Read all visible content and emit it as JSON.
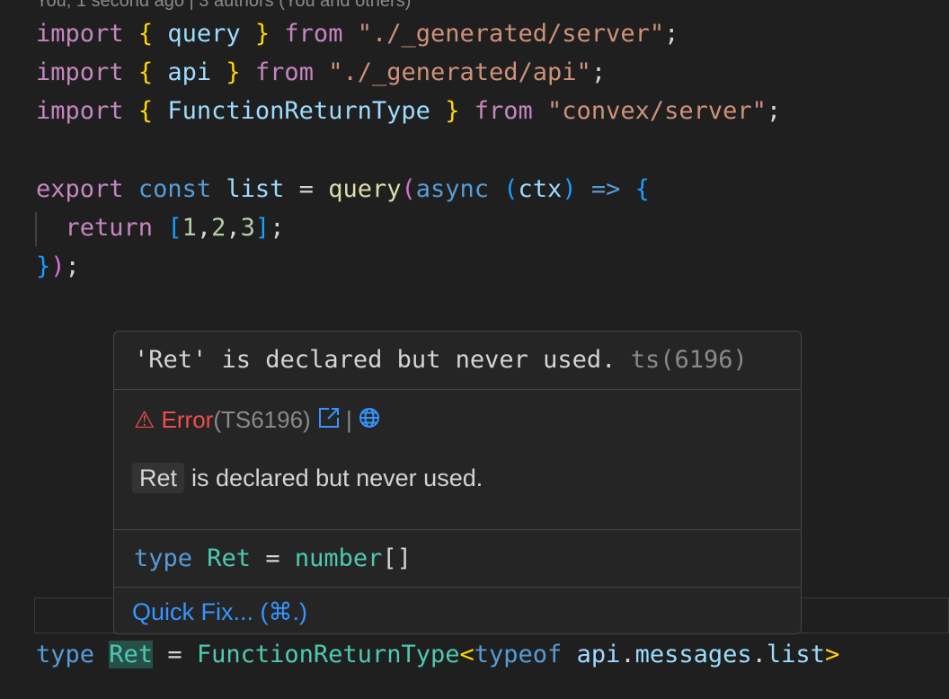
{
  "editor": {
    "blame": "You, 1 second ago | 3 authors (You and others)",
    "line1": {
      "kw": "import",
      "ob": "{",
      "name": "query",
      "cb": "}",
      "from": "from",
      "src": "\"./_generated/server\"",
      "semi": ";"
    },
    "line2": {
      "kw": "import",
      "ob": "{",
      "name": "api",
      "cb": "}",
      "from": "from",
      "src": "\"./_generated/api\"",
      "semi": ";"
    },
    "line3": {
      "kw": "import",
      "ob": "{",
      "name": "FunctionReturnType",
      "cb": "}",
      "from": "from",
      "src": "\"convex/server\"",
      "semi": ";"
    },
    "line4": {
      "export": "export",
      "const": "const",
      "name": "list",
      "eq": "=",
      "fn": "query",
      "lp": "(",
      "async": "async",
      "plp": "(",
      "arg": "ctx",
      "prp": ")",
      "arrow": "=>",
      "ob": "{"
    },
    "line5": {
      "ret": "return",
      "lb": "[",
      "n1": "1",
      "c1": ",",
      "n2": "2",
      "c2": ",",
      "n3": "3",
      "rb": "]",
      "semi": ";"
    },
    "line6": {
      "cb": "}",
      "rp": ")",
      "semi": ";"
    },
    "line7": {
      "type": "type",
      "name": "Ret",
      "eq": "=",
      "fn": "FunctionReturnType",
      "lt": "<",
      "typeof": "typeof",
      "obj": "api",
      "dot1": ".",
      "prop1": "messages",
      "dot2": ".",
      "prop2": "list",
      "gt": ">"
    }
  },
  "hover": {
    "diagnostic_text": "'Ret' is declared but never used.",
    "diagnostic_code": "ts(6196)",
    "warning_glyph": "⚠",
    "error_label": "Error",
    "error_code": "(TS6196)",
    "separator": "|",
    "message_code": "Ret",
    "message_text": "is declared but never used.",
    "signature": {
      "kw": "type",
      "name": "Ret",
      "eq": "=",
      "t": "number",
      "br": "[]"
    },
    "quick_fix": "Quick Fix... (⌘.)"
  },
  "icons": [
    "warning-icon",
    "external-link-icon",
    "globe-icon"
  ],
  "colors": {
    "background": "#1f1f1f",
    "hover_bg": "#252526",
    "link": "#3794ff",
    "error": "#f14c4c"
  }
}
